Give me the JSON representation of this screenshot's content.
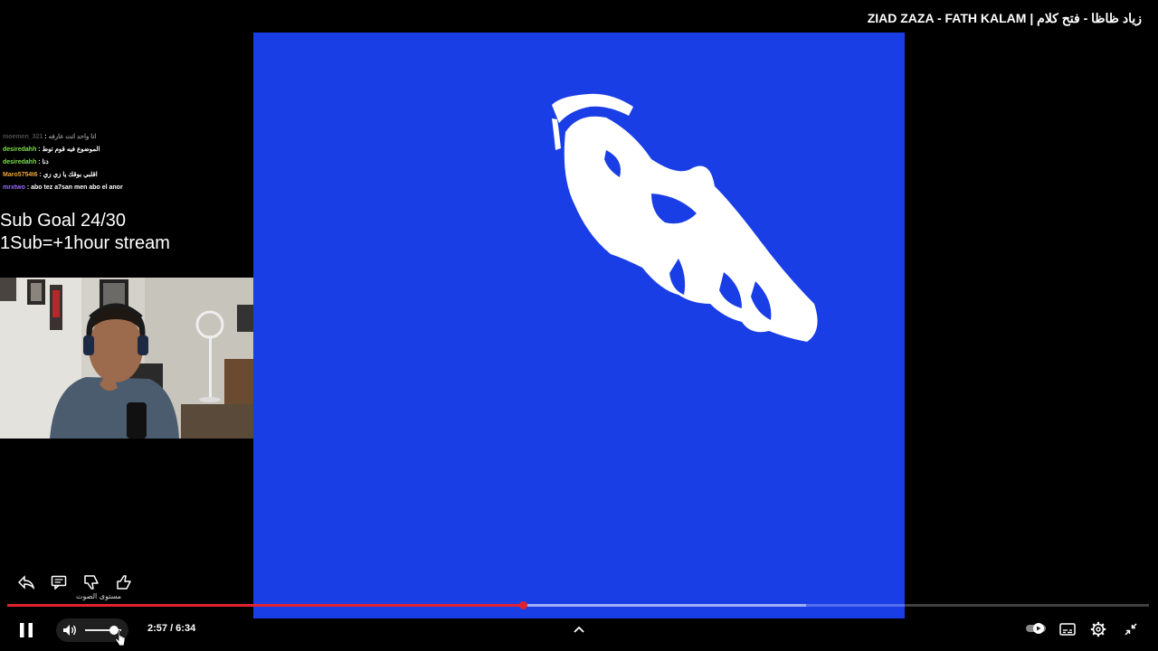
{
  "video": {
    "title": "ZIAD ZAZA - FATH KALAM | زياد ظاظا - فتح كلام"
  },
  "chat": {
    "messages": [
      {
        "user": "moemen_321",
        "text": "انا واحد انت عارفه",
        "color": "#8a8a8a"
      },
      {
        "user": "desiredahh",
        "text": "الموضوع فيه قوم توط",
        "color": "#7ee04a"
      },
      {
        "user": "desiredahh",
        "text": "ذنا",
        "color": "#7ee04a"
      },
      {
        "user": "Maro5754t6",
        "text": "اقلبي بوقك يا زي زي",
        "color": "#f0a33a"
      },
      {
        "user": "mrxtwo",
        "text": "abo tez a7san men abo el anor",
        "color": "#9b6bff"
      }
    ]
  },
  "overlay": {
    "sub_goal": "Sub Goal 24/30",
    "sub_rule": "1Sub=+1hour stream"
  },
  "actions": {
    "tooltip": "مستوى الصوت"
  },
  "player": {
    "time_display": "2:57 / 6:34",
    "played_fraction": 0.452,
    "buffered_fraction": 0.7,
    "volume_fraction": 0.8,
    "accent_color": "#e0222f",
    "icons": [
      "pause-icon",
      "volume-icon",
      "chevron-up-icon",
      "autoplay-toggle-icon",
      "subtitles-icon",
      "settings-gear-icon",
      "exit-fullscreen-icon",
      "share-icon",
      "comment-icon",
      "dislike-icon",
      "like-icon"
    ]
  }
}
